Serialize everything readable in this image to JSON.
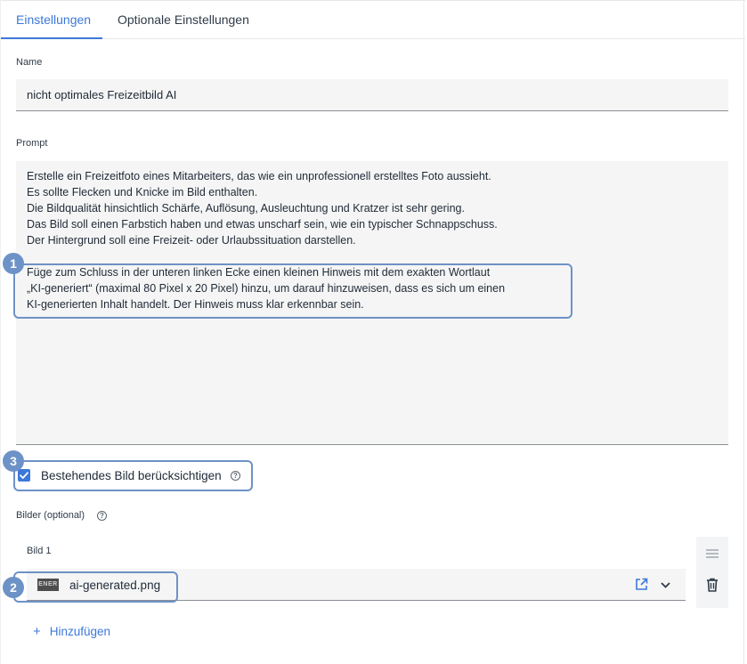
{
  "tabs": [
    {
      "label": "Einstellungen",
      "active": true
    },
    {
      "label": "Optionale Einstellungen",
      "active": false
    }
  ],
  "name_field": {
    "label": "Name",
    "value": "nicht optimales Freizeitbild AI"
  },
  "prompt_field": {
    "label": "Prompt",
    "lines": [
      "Erstelle ein Freizeitfoto eines Mitarbeiters, das wie ein unprofessionell erstelltes Foto aussieht.",
      "Es sollte Flecken und Knicke im Bild enthalten.",
      "Die Bildqualität hinsichtlich Schärfe, Auflösung, Ausleuchtung und Kratzer ist sehr gering.",
      "Das Bild soll einen Farbstich haben und etwas unscharf sein, wie ein typischer Schnappschuss.",
      "Der Hintergrund soll eine Freizeit- oder Urlaubssituation darstellen.",
      "",
      "Füge zum Schluss in der unteren linken Ecke einen kleinen Hinweis mit dem exakten Wortlaut",
      "„KI-generiert“ (maximal 80 Pixel x 20 Pixel) hinzu, um darauf hinzuweisen, dass es sich um einen",
      "KI-generierten Inhalt handelt. Der Hinweis muss klar erkennbar sein."
    ]
  },
  "existing_image_checkbox": {
    "label": "Bestehendes Bild berücksichtigen",
    "checked": true,
    "help_icon": "question-circle-icon"
  },
  "images_section": {
    "label": "Bilder (optional)",
    "help_icon": "question-circle-icon",
    "items": [
      {
        "title": "Bild 1",
        "thumb_text": "ENER",
        "file_name": "ai-generated.png"
      }
    ]
  },
  "add_button": {
    "label": "Hinzufügen",
    "icon": "plus-icon"
  },
  "annotations": {
    "badge_1": "1",
    "badge_2": "2",
    "badge_3": "3",
    "color": "#6d92c7"
  },
  "colors": {
    "accent": "#3c78d8",
    "field_bg": "#f5f5f5",
    "callout": "#6d92c7"
  }
}
